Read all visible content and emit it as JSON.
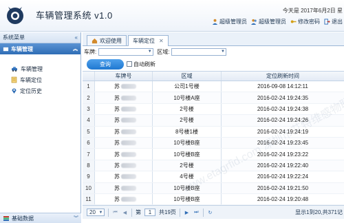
{
  "header": {
    "title": "车辆管理系统 v1.0",
    "datetime": "今天是 2017年6月2日 星",
    "links": [
      "超级管理员",
      "超级管理员",
      "修改密码",
      "退出"
    ]
  },
  "sidebar": {
    "title": "系统菜单",
    "group": "车辆管理",
    "items": [
      {
        "label": "车辆管理",
        "icon": "car-icon"
      },
      {
        "label": "车辆定位",
        "icon": "document-icon"
      },
      {
        "label": "定位历史",
        "icon": "location-icon"
      }
    ],
    "bottom_group": "基础数据"
  },
  "tabs": [
    {
      "label": "欢迎使用",
      "active": false
    },
    {
      "label": "车辆定位",
      "active": true
    }
  ],
  "filters": {
    "plate_label": "车牌:",
    "area_label": "区域:"
  },
  "actions": {
    "query": "查询",
    "auto_refresh": "自动刷新"
  },
  "table": {
    "columns": [
      "车牌号",
      "区域",
      "定位刷新时间"
    ],
    "rows": [
      {
        "idx": "1",
        "plate": "苏",
        "area": "公司1号楼",
        "time": "2016-09-08 14:12:11"
      },
      {
        "idx": "2",
        "plate": "苏",
        "area": "10号楼A座",
        "time": "2016-02-24 19:24:35"
      },
      {
        "idx": "3",
        "plate": "苏",
        "area": "2号楼",
        "time": "2016-02-24 19:24:38"
      },
      {
        "idx": "4",
        "plate": "苏",
        "area": "2号楼",
        "time": "2016-02-24 19:24:26"
      },
      {
        "idx": "5",
        "plate": "苏",
        "area": "8号楼1楼",
        "time": "2016-02-24 19:24:19"
      },
      {
        "idx": "6",
        "plate": "苏",
        "area": "10号楼B座",
        "time": "2016-02-24 19:23:45"
      },
      {
        "idx": "7",
        "plate": "苏",
        "area": "10号楼B座",
        "time": "2016-02-24 19:23:22"
      },
      {
        "idx": "8",
        "plate": "苏",
        "area": "2号楼",
        "time": "2016-02-24 19:22:40"
      },
      {
        "idx": "9",
        "plate": "苏",
        "area": "4号楼",
        "time": "2016-02-24 19:22:24"
      },
      {
        "idx": "10",
        "plate": "苏",
        "area": "10号楼B座",
        "time": "2016-02-24 19:21:50"
      },
      {
        "idx": "11",
        "plate": "苏",
        "area": "10号楼B座",
        "time": "2016-02-24 19:20:48"
      }
    ]
  },
  "pager": {
    "page_size": "20",
    "page_prefix": "第",
    "page_value": "1",
    "page_suffix": "共19页",
    "info": "显示1到20,共371记"
  },
  "watermark": "www.etagrfid.com 深圳市艾特维感物联"
}
